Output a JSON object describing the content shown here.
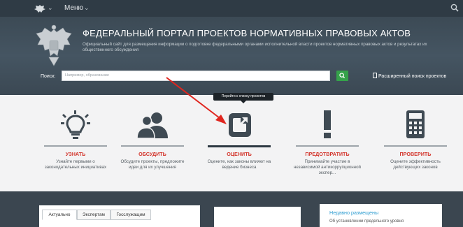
{
  "topbar": {
    "menu_label": "Меню"
  },
  "hero": {
    "title": "ФЕДЕРАЛЬНЫЙ ПОРТАЛ ПРОЕКТОВ НОРМАТИВНЫХ ПРАВОВЫХ АКТОВ",
    "subtitle": "Официальный сайт для размещения информации о подготовке федеральными органами исполнительной власти проектов нормативных правовых актов и результатах их общественного обсуждения",
    "search_label": "Поиск:",
    "search_placeholder": "Например, образование",
    "advanced_search": "Расширенный поиск проектов"
  },
  "tooltip": "Перейти к списку проектов",
  "features": [
    {
      "title": "УЗНАТЬ",
      "desc": "Узнайте первыми о законодательных инициативах",
      "icon": "lightbulb-icon"
    },
    {
      "title": "ОБСУДИТЬ",
      "desc": "Обсудите проекты, предложите идеи для их улучшения",
      "icon": "people-icon"
    },
    {
      "title": "ОЦЕНИТЬ",
      "desc": "Оцените, как законы влияют на ведение бизнеса",
      "icon": "external-link-icon"
    },
    {
      "title": "ПРЕДОТВРАТИТЬ",
      "desc": "Принимайте участие в независимой антикоррупционной экспер...",
      "icon": "exclamation-icon"
    },
    {
      "title": "ПРОВЕРИТЬ",
      "desc": "Оцените эффективность действующих законов",
      "icon": "calculator-icon"
    }
  ],
  "tabs": [
    "Актуально",
    "Экспертам",
    "Госслужащим"
  ],
  "news": {
    "title": "Недавно размещены",
    "first_item": "Об установлении предельного уровня"
  },
  "colors": {
    "accent_red": "#d3342b",
    "search_green": "#35a24a",
    "dark_bar": "#2f3b45"
  }
}
